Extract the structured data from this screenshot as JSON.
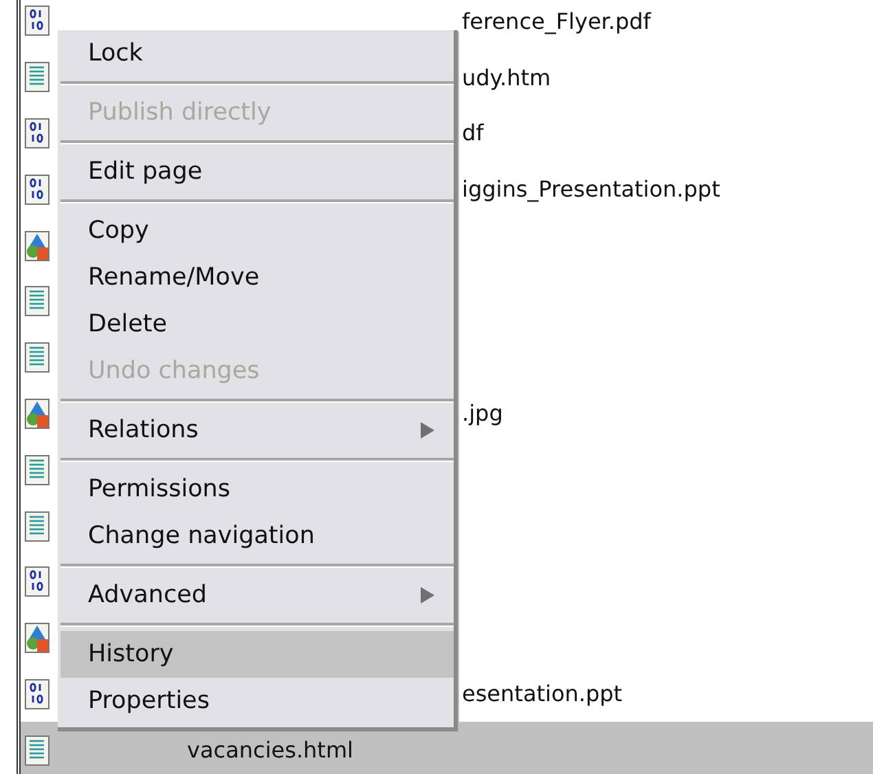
{
  "files": [
    {
      "kind": "binary",
      "name": "ference_Flyer.pdf",
      "selected": false
    },
    {
      "kind": "document",
      "name": "udy.htm",
      "selected": false
    },
    {
      "kind": "binary",
      "name": "df",
      "selected": false
    },
    {
      "kind": "binary",
      "name": "iggins_Presentation.ppt",
      "selected": false
    },
    {
      "kind": "image",
      "selected": false
    },
    {
      "kind": "document",
      "selected": false
    },
    {
      "kind": "document",
      "selected": false
    },
    {
      "kind": "image",
      "name": ".jpg",
      "selected": false
    },
    {
      "kind": "document",
      "selected": false
    },
    {
      "kind": "document",
      "selected": false
    },
    {
      "kind": "binary",
      "selected": false
    },
    {
      "kind": "image",
      "selected": false
    },
    {
      "kind": "binary",
      "name": "esentation.ppt",
      "selected": false
    },
    {
      "kind": "document",
      "name": "vacancies.html",
      "selected": true
    }
  ],
  "context_menu": {
    "groups": [
      [
        {
          "label": "Lock",
          "disabled": false,
          "submenu": false,
          "selected": false
        }
      ],
      [
        {
          "label": "Publish directly",
          "disabled": true,
          "submenu": false,
          "selected": false
        }
      ],
      [
        {
          "label": "Edit page",
          "disabled": false,
          "submenu": false,
          "selected": false
        }
      ],
      [
        {
          "label": "Copy",
          "disabled": false,
          "submenu": false,
          "selected": false
        },
        {
          "label": "Rename/Move",
          "disabled": false,
          "submenu": false,
          "selected": false
        },
        {
          "label": "Delete",
          "disabled": false,
          "submenu": false,
          "selected": false
        },
        {
          "label": "Undo changes",
          "disabled": true,
          "submenu": false,
          "selected": false
        }
      ],
      [
        {
          "label": "Relations",
          "disabled": false,
          "submenu": true,
          "selected": false
        }
      ],
      [
        {
          "label": "Permissions",
          "disabled": false,
          "submenu": false,
          "selected": false
        },
        {
          "label": "Change navigation",
          "disabled": false,
          "submenu": false,
          "selected": false
        }
      ],
      [
        {
          "label": "Advanced",
          "disabled": false,
          "submenu": true,
          "selected": false
        }
      ],
      [
        {
          "label": "History",
          "disabled": false,
          "submenu": false,
          "selected": true
        },
        {
          "label": "Properties",
          "disabled": false,
          "submenu": false,
          "selected": false
        }
      ]
    ]
  }
}
